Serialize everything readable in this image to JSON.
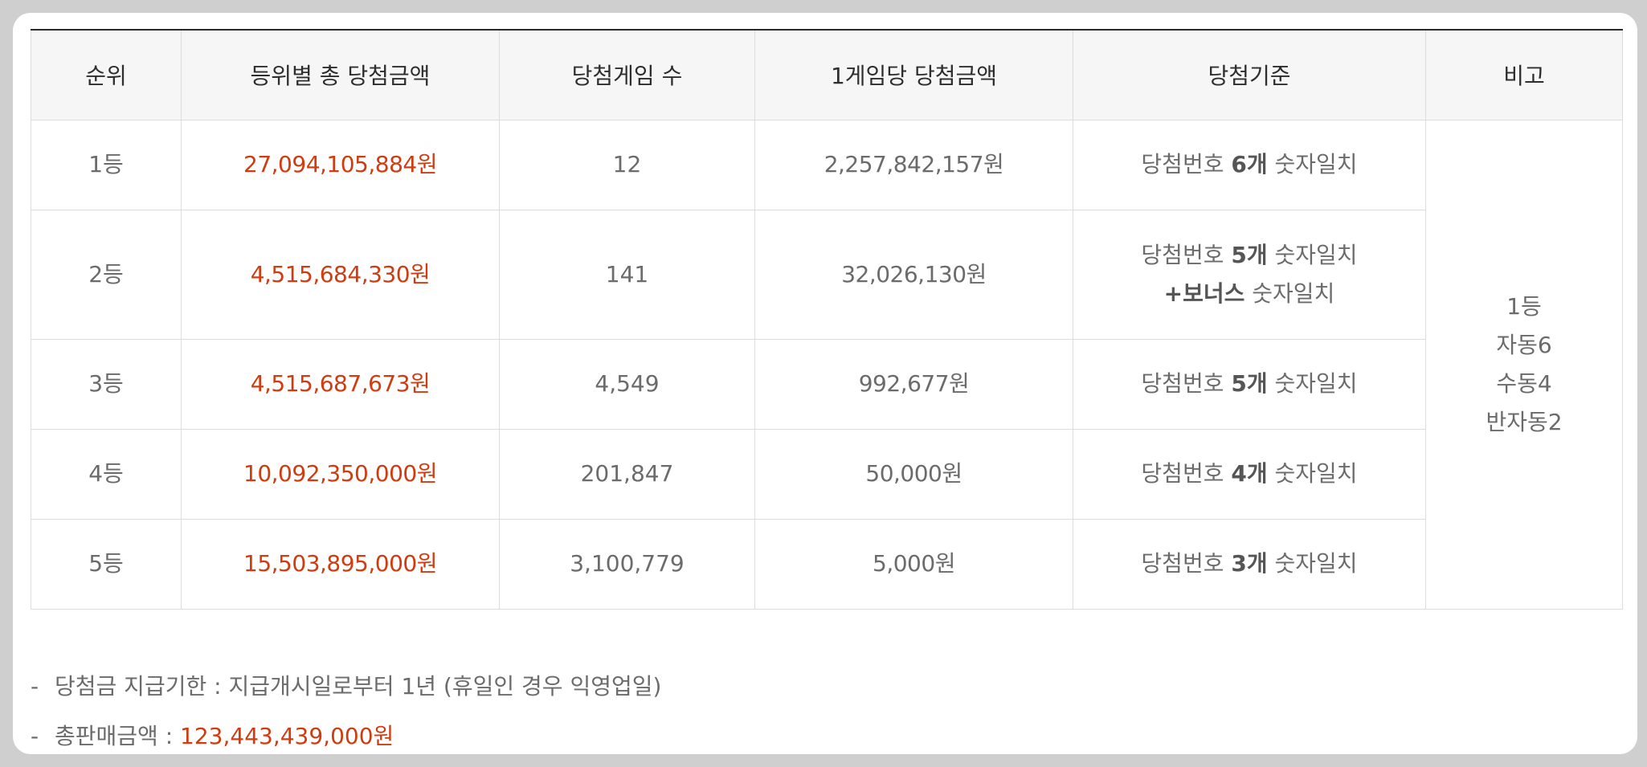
{
  "table": {
    "headers": [
      "순위",
      "등위별 총 당첨금액",
      "당첨게임 수",
      "1게임당 당첨금액",
      "당첨기준",
      "비고"
    ],
    "rows": [
      {
        "rank": "1등",
        "total": "27,094,105,884원",
        "games": "12",
        "per_game": "2,257,842,157원",
        "criteria": {
          "prefix": "당첨번호 ",
          "count": "6개",
          "suffix": " 숫자일치"
        }
      },
      {
        "rank": "2등",
        "total": "4,515,684,330원",
        "games": "141",
        "per_game": "32,026,130원",
        "criteria": {
          "prefix": "당첨번호 ",
          "count": "5개",
          "suffix": " 숫자일치",
          "bonus_prefix": "+",
          "bonus": "보너스",
          "bonus_suffix": " 숫자일치"
        }
      },
      {
        "rank": "3등",
        "total": "4,515,687,673원",
        "games": "4,549",
        "per_game": "992,677원",
        "criteria": {
          "prefix": "당첨번호 ",
          "count": "5개",
          "suffix": " 숫자일치"
        }
      },
      {
        "rank": "4등",
        "total": "10,092,350,000원",
        "games": "201,847",
        "per_game": "50,000원",
        "criteria": {
          "prefix": "당첨번호 ",
          "count": "4개",
          "suffix": " 숫자일치"
        }
      },
      {
        "rank": "5등",
        "total": "15,503,895,000원",
        "games": "3,100,779",
        "per_game": "5,000원",
        "criteria": {
          "prefix": "당첨번호 ",
          "count": "3개",
          "suffix": " 숫자일치"
        }
      }
    ],
    "remark": [
      "1등",
      "자동6",
      "수동4",
      "반자동2"
    ]
  },
  "notes": {
    "dash": "-",
    "payout_label": "당첨금 지급기한 : ",
    "payout_value": "지급개시일로부터 1년 (휴일인 경우 익영업일)",
    "sales_label": "총판매금액 : ",
    "sales_value": "123,443,439,000원"
  },
  "colors": {
    "accent_red": "#d03c10",
    "header_bg": "#f6f6f6",
    "text_gray": "#6b6b6b"
  }
}
